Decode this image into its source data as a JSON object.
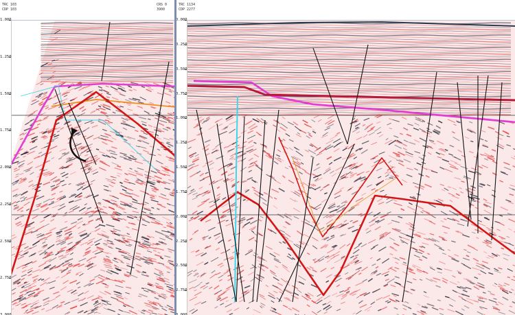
{
  "left_panel": {
    "header": {
      "line1": "TRC 103",
      "line2": "CDP 103",
      "right1": "CRS 0",
      "right2": "3900"
    },
    "time_axis": [
      "1.000",
      "1.250",
      "1.500",
      "1.750",
      "2.000",
      "2.250",
      "2.500",
      "2.750",
      "3.000"
    ]
  },
  "right_panel": {
    "header": {
      "line1": "TRC 1134",
      "line2": "CDP 2277"
    },
    "time_axis": [
      "0.000",
      "0.250",
      "0.500",
      "0.750",
      "1.000",
      "1.250",
      "1.500",
      "1.750",
      "2.000",
      "2.250",
      "2.500",
      "2.750",
      "3.000"
    ]
  },
  "colors": {
    "background": "#fdf0f0",
    "reflector_red": "#e33b3b",
    "reflector_dark": "#1a1a2a",
    "horizon_magenta": "#e23fd2",
    "horizon_red": "#d41515",
    "horizon_orange": "#f08c1a",
    "horizon_cyan": "#3cd7e8",
    "fault": "#111111"
  }
}
